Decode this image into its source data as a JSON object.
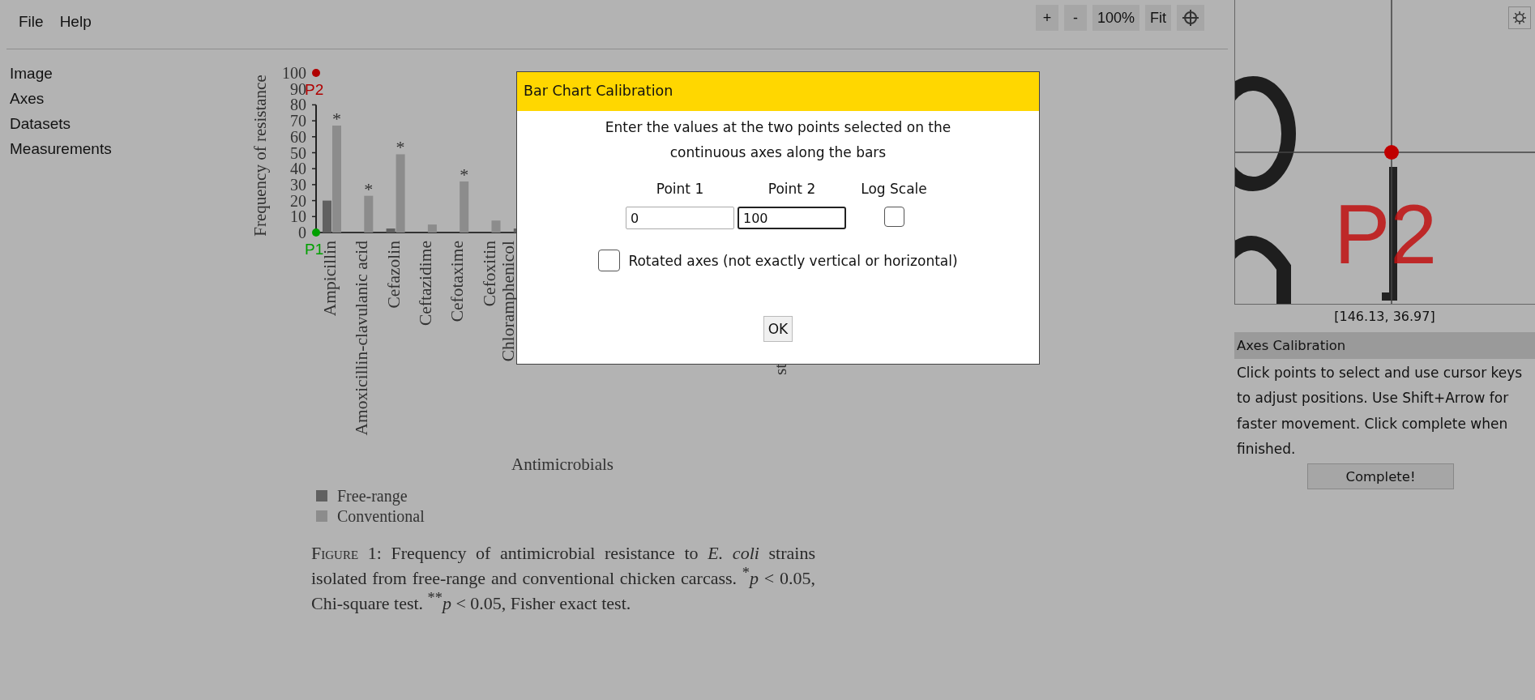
{
  "menu": [
    {
      "label": "File"
    },
    {
      "label": "Help"
    }
  ],
  "toolbar": [
    {
      "label": "+",
      "kind": "text"
    },
    {
      "label": "-",
      "kind": "text"
    },
    {
      "label": "100%",
      "kind": "text"
    },
    {
      "label": "Fit",
      "kind": "text"
    },
    {
      "kind": "crosshair"
    }
  ],
  "sidebar": {
    "items": [
      {
        "label": "Image"
      },
      {
        "label": "Axes"
      },
      {
        "label": "Datasets"
      },
      {
        "label": "Measurements"
      }
    ]
  },
  "figure": {
    "chart_data": {
      "type": "bar",
      "ylabel": "Frequency of resistance",
      "xlabel": "Antimicrobials",
      "categories": [
        "Ampicillin",
        "Amoxicillin-clavulanic acid",
        "Cefazolin",
        "Ceftazidime",
        "Cefotaxime",
        "Cefoxitin",
        "Chloramphenicol"
      ],
      "series": [
        {
          "name": "Free-range",
          "color": "#606060",
          "values": [
            20,
            0,
            2.5,
            0,
            0,
            0,
            2.5
          ]
        },
        {
          "name": "Conventional",
          "color": "#8c8c8c",
          "values": [
            67,
            23,
            49,
            5,
            32,
            7.5,
            null
          ]
        }
      ],
      "ylim": [
        0,
        100
      ],
      "yticks": [
        {
          "value": 0,
          "label": "0"
        },
        10,
        20,
        30,
        40,
        50,
        60,
        70,
        80,
        90,
        {
          "value": 100,
          "label": "100"
        }
      ],
      "legend": true,
      "annotations": [
        {
          "x": "Ampicillin",
          "y": 67,
          "text": "*"
        },
        {
          "x": "Amoxicillin-clavulanic acid",
          "y": 23,
          "text": "*"
        },
        {
          "x": "Cefazolin",
          "y": 49,
          "text": "*"
        },
        {
          "x": "Cefotaxime",
          "y": 32,
          "text": "*"
        }
      ]
    },
    "label_fragment": "st",
    "caption": {
      "label": "Figure 1:",
      "text": "Frequency of antimicrobial resistance to *E. coli* strains isolated from free-range and conventional chicken carcass. $^{*}$*p* < 0.05, Chi-square test. $^{**}$*p* < 0.05, Fisher exact test."
    },
    "calibration_points": [
      {
        "label": "P2",
        "color": "#b00000"
      },
      {
        "label": "P1",
        "color": "#00a000"
      }
    ]
  },
  "magnifier": {
    "point_label": "P2",
    "coordinates": "[146.13, 36.97]"
  },
  "panel": {
    "title": "Axes Calibration",
    "instructions": "Click points to select and use cursor keys to adjust positions. Use Shift+Arrow for faster movement. Click complete when finished.",
    "button": "Complete!"
  },
  "dialog": {
    "title": "Bar Chart Calibration",
    "message": "Enter the values at the two points selected on the continuous axes along the bars",
    "fields": [
      {
        "label": "Point 1",
        "value": "0",
        "focused": false
      },
      {
        "label": "Point 2",
        "value": "100",
        "focused": true
      }
    ],
    "log_scale": {
      "label": "Log Scale",
      "checked": false
    },
    "rotated": {
      "label": "Rotated axes (not exactly vertical or horizontal)",
      "checked": false
    },
    "button": "OK"
  }
}
